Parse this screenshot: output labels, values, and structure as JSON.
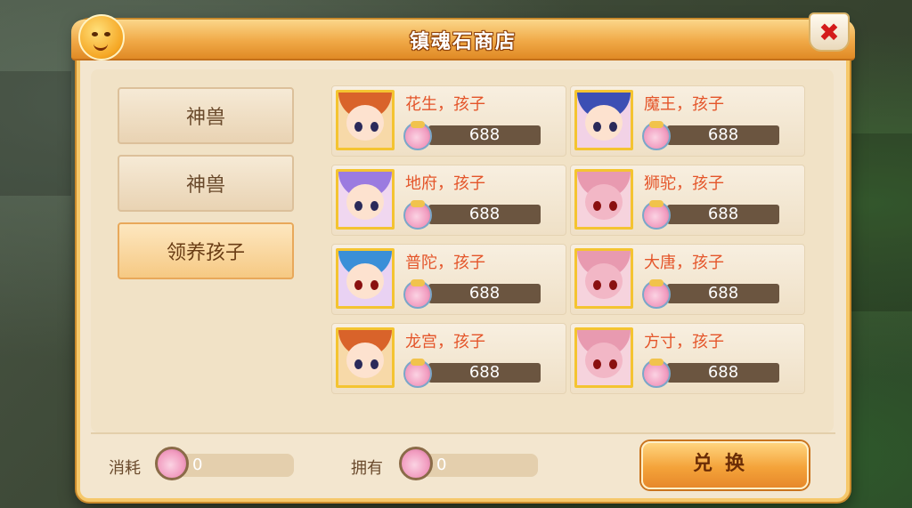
{
  "title": "镇魂石商店",
  "tabs": [
    "神兽",
    "神兽",
    "领养孩子"
  ],
  "active_tab": 2,
  "items": [
    {
      "name": "花生，孩子",
      "price": "688",
      "avatar": "red-hair-girl"
    },
    {
      "name": "魔王，孩子",
      "price": "688",
      "avatar": "blue-hair-girl"
    },
    {
      "name": "地府，孩子",
      "price": "688",
      "avatar": "purple-bun-boy"
    },
    {
      "name": "狮驼，孩子",
      "price": "688",
      "avatar": "pink-horn-demon"
    },
    {
      "name": "普陀，孩子",
      "price": "688",
      "avatar": "blue-hair-fairy"
    },
    {
      "name": "大唐，孩子",
      "price": "688",
      "avatar": "pink-horn-demon"
    },
    {
      "name": "龙宫，孩子",
      "price": "688",
      "avatar": "red-hair-girl"
    },
    {
      "name": "方寸，孩子",
      "price": "688",
      "avatar": "pink-horn-demon"
    }
  ],
  "footer": {
    "cost_label": "消耗",
    "cost_value": "0",
    "own_label": "拥有",
    "own_value": "0",
    "exchange_label": "兑换"
  },
  "colors": {
    "accent": "#f4a33a",
    "price_bg": "#6b5540",
    "name": "#e4552a"
  }
}
